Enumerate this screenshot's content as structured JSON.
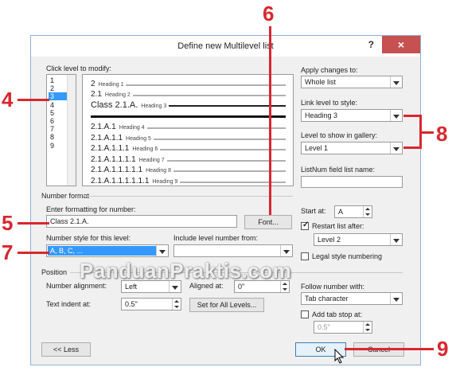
{
  "dialog": {
    "title": "Define new Multilevel list",
    "help_label": "?",
    "close_label": "×"
  },
  "level_panel": {
    "label": "Click level to modify:",
    "levels": [
      "1",
      "2",
      "3",
      "4",
      "5",
      "6",
      "7",
      "8",
      "9"
    ],
    "selected": "3"
  },
  "preview": {
    "rows": [
      {
        "number": "2",
        "heading": "Heading 1"
      },
      {
        "number": "2.1",
        "heading": "Heading 2"
      },
      {
        "number": "Class 2.1.A.",
        "heading": "Heading 3"
      },
      {
        "number": "2.1.A.1",
        "heading": "Heading 4"
      },
      {
        "number": "2.1.A.1.1",
        "heading": "Heading 5"
      },
      {
        "number": "2.1.A.1.1.1",
        "heading": "Heading 6"
      },
      {
        "number": "2.1.A.1.1.1.1",
        "heading": "Heading 7"
      },
      {
        "number": "2.1.A.1.1.1.1.1",
        "heading": "Heading 8"
      },
      {
        "number": "2.1.A.1.1.1.1.1.1",
        "heading": "Heading 9"
      }
    ]
  },
  "apply_changes": {
    "label": "Apply changes to:",
    "value": "Whole list"
  },
  "link_level": {
    "label": "Link level to style:",
    "value": "Heading 3"
  },
  "level_gallery": {
    "label": "Level to show in gallery:",
    "value": "Level 1"
  },
  "listnum": {
    "label": "ListNum field list name:",
    "value": ""
  },
  "number_format": {
    "section_label": "Number format",
    "formatting_label": "Enter formatting for number:",
    "formatting_value": "Class 2.1.A.",
    "font_button": "Font...",
    "style_label": "Number style for this level:",
    "style_value": "A, B, C, ...",
    "include_label": "Include level number from:",
    "include_value": ""
  },
  "start_at": {
    "label": "Start at:",
    "value": "A"
  },
  "restart": {
    "label": "Restart list after:",
    "checked": true,
    "value": "Level 2"
  },
  "legal": {
    "label": "Legal style numbering",
    "checked": false
  },
  "position": {
    "section_label": "Position",
    "alignment_label": "Number alignment:",
    "alignment_value": "Left",
    "aligned_at_label": "Aligned at:",
    "aligned_at_value": "0\"",
    "indent_label": "Text indent at:",
    "indent_value": "0.5\"",
    "set_all_button": "Set for All Levels...",
    "follow_label": "Follow number with:",
    "follow_value": "Tab character",
    "add_tab_label": "Add tab stop at:",
    "add_tab_checked": false,
    "add_tab_value": "0.5\""
  },
  "buttons": {
    "less": "<< Less",
    "ok": "OK",
    "cancel": "Cancel"
  },
  "callouts": {
    "c4": "4",
    "c5": "5",
    "c6": "6",
    "c7": "7",
    "c8": "8",
    "c9": "9"
  },
  "watermark": "PanduanPraktis.com",
  "colors": {
    "callout": "#d9272e",
    "selection": "#3399ff",
    "close": "#c75050"
  }
}
